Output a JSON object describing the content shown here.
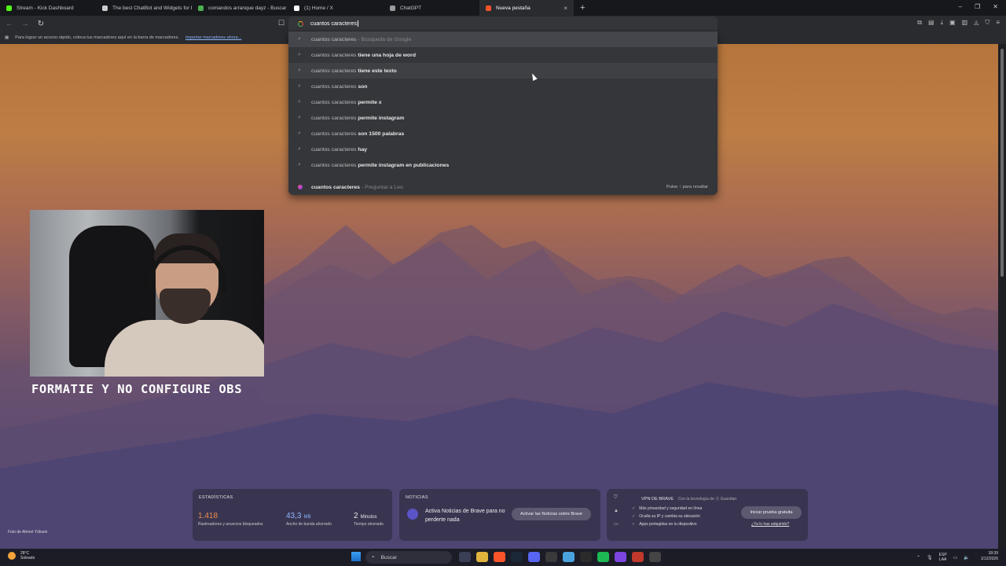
{
  "browser": {
    "tabs": [
      {
        "title": "Stream - Kick Dashboard",
        "favicon_color": "#53fc18",
        "active": false
      },
      {
        "title": "The best ChatBot and Widgets for Ki",
        "favicon_color": "#cccccc",
        "active": false
      },
      {
        "title": "comandos arranque dayz - Buscar c",
        "favicon_color": "#4caf50",
        "active": false
      },
      {
        "title": "(1) Home / X",
        "favicon_color": "#ffffff",
        "active": false
      },
      {
        "title": "ChatGPT",
        "favicon_color": "#9a9a9a",
        "active": false
      },
      {
        "title": "Nueva pestaña",
        "favicon_color": "#fb542b",
        "active": true
      }
    ],
    "new_tab_symbol": "+",
    "close_symbol": "×",
    "window_controls": [
      "–",
      "❐",
      "✕"
    ],
    "nav": {
      "back": "←",
      "forward": "→",
      "reload": "↻"
    },
    "bookmarks_bar": {
      "text": "Para lograr un acceso rápido, coloca tus marcadores aquí en la barra de marcadores.",
      "link": "Importar marcadores ahora..."
    },
    "toolbar_icons": [
      "puzzle-icon",
      "sidebar-icon",
      "download-icon",
      "wallet-icon",
      "tab-icon",
      "rewards-icon",
      "vpn-icon",
      "menu-icon"
    ]
  },
  "omnibox": {
    "value": "cuantos caracteres",
    "suggestions": [
      {
        "prefix": "cuantos caracteres",
        "bold": "",
        "note": " - Búsqueda de Google"
      },
      {
        "prefix": "cuantos caracteres ",
        "bold": "tiene una hoja de word",
        "note": ""
      },
      {
        "prefix": "cuantos caracteres ",
        "bold": "tiene este texto",
        "note": ""
      },
      {
        "prefix": "cuantos caracteres ",
        "bold": "son",
        "note": ""
      },
      {
        "prefix": "cuantos caracteres ",
        "bold": "permite x",
        "note": ""
      },
      {
        "prefix": "cuantos caracteres ",
        "bold": "permite instagram",
        "note": ""
      },
      {
        "prefix": "cuantos caracteres ",
        "bold": "son 1500 palabras",
        "note": ""
      },
      {
        "prefix": "cuantos caracteres ",
        "bold": "hay",
        "note": ""
      },
      {
        "prefix": "cuantos caracteres ",
        "bold": "permite instagram en publicaciones",
        "note": ""
      }
    ],
    "leo": {
      "query": "cuantos caracteres",
      "note": " - Preguntar a Leo",
      "hint": "Pulse ↑ para resaltar"
    }
  },
  "overlay": {
    "caption": "FORMATIE Y NO CONFIGURE OBS"
  },
  "widgets": {
    "stats": {
      "title": "ESTADÍSTICAS",
      "items": [
        {
          "value": "1.418",
          "unit": "",
          "label": "Rastreadores y anuncios bloqueados",
          "color": "#f08c4b"
        },
        {
          "value": "43,3",
          "unit": "MB",
          "label": "Ancho de banda ahorrado",
          "color": "#8fb5ff"
        },
        {
          "value": "2",
          "unit": "Minutos",
          "label": "Tiempo ahorrado",
          "color": "#ffffff"
        }
      ]
    },
    "news": {
      "title": "NOTICIAS",
      "text": "Activa Noticias de Brave para no perderte nada",
      "button": "Activar las Noticias sobre Brave"
    },
    "vpn": {
      "title": "VPN DE BRAVE",
      "subtitle": "Con la tecnología de ⓖ Guardian",
      "features": [
        "Más privacidad y seguridad en línea",
        "Oculta su IP y cambia su ubicación",
        "Apps protegidas en tu dispositivo"
      ],
      "button": "Iniciar prueba gratuita",
      "link": "¿Ya lo has adquirido?"
    },
    "photo_credit": "Foto de Ahmet Yüksek"
  },
  "taskbar": {
    "weather_temp": "28°C",
    "weather_desc": "Soleado",
    "search_placeholder": "Buscar",
    "lang_top": "ESP",
    "lang_bottom": "LAA",
    "time": "18:39",
    "date": "1/12/2026",
    "apps": [
      {
        "name": "file-explorer-icon",
        "color": "#3b3f55"
      },
      {
        "name": "folder-icon",
        "color": "#e0b43c"
      },
      {
        "name": "brave-icon",
        "color": "#fb542b"
      },
      {
        "name": "steam-icon",
        "color": "#1b2838"
      },
      {
        "name": "discord-icon",
        "color": "#5865f2"
      },
      {
        "name": "capcut-icon",
        "color": "#3a3a3a"
      },
      {
        "name": "notepad-icon",
        "color": "#4aa3df"
      },
      {
        "name": "obs-icon",
        "color": "#2b2b2b"
      },
      {
        "name": "spotify-icon",
        "color": "#1db954"
      },
      {
        "name": "app-grid-icon",
        "color": "#7b45e0"
      },
      {
        "name": "sql-icon",
        "color": "#c0392b"
      },
      {
        "name": "game-icon",
        "color": "#444444"
      }
    ]
  }
}
